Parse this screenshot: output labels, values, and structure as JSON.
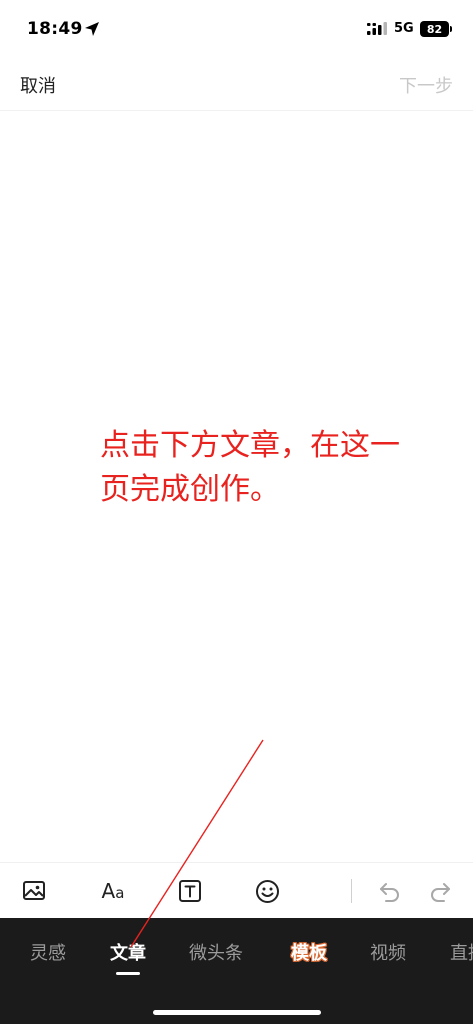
{
  "status_bar": {
    "time": "18:49",
    "network": "5G",
    "battery": "82"
  },
  "header": {
    "cancel_label": "取消",
    "next_label": "下一步"
  },
  "editor": {
    "annotation_line1": "点击下方文章，在这一",
    "annotation_line2": "页完成创作。",
    "annotation_color": "#e8231f"
  },
  "toolbar": {
    "image_icon": "image-icon",
    "font_label": "A",
    "font_label_small": "a",
    "textbox_icon": "text-box-icon",
    "emoji_icon": "emoji-icon",
    "undo_icon": "undo-icon",
    "redo_icon": "redo-icon"
  },
  "tabs": [
    {
      "label": "灵感",
      "active": false
    },
    {
      "label": "文章",
      "active": true
    },
    {
      "label": "微头条",
      "active": false
    },
    {
      "label": "模板",
      "active": false,
      "highlight_color": "#d96a33"
    },
    {
      "label": "视频",
      "active": false
    },
    {
      "label": "直播",
      "active": false
    }
  ],
  "colors": {
    "tab_bar_bg": "#1b1b1b",
    "disabled_text": "#c8c8c8"
  }
}
